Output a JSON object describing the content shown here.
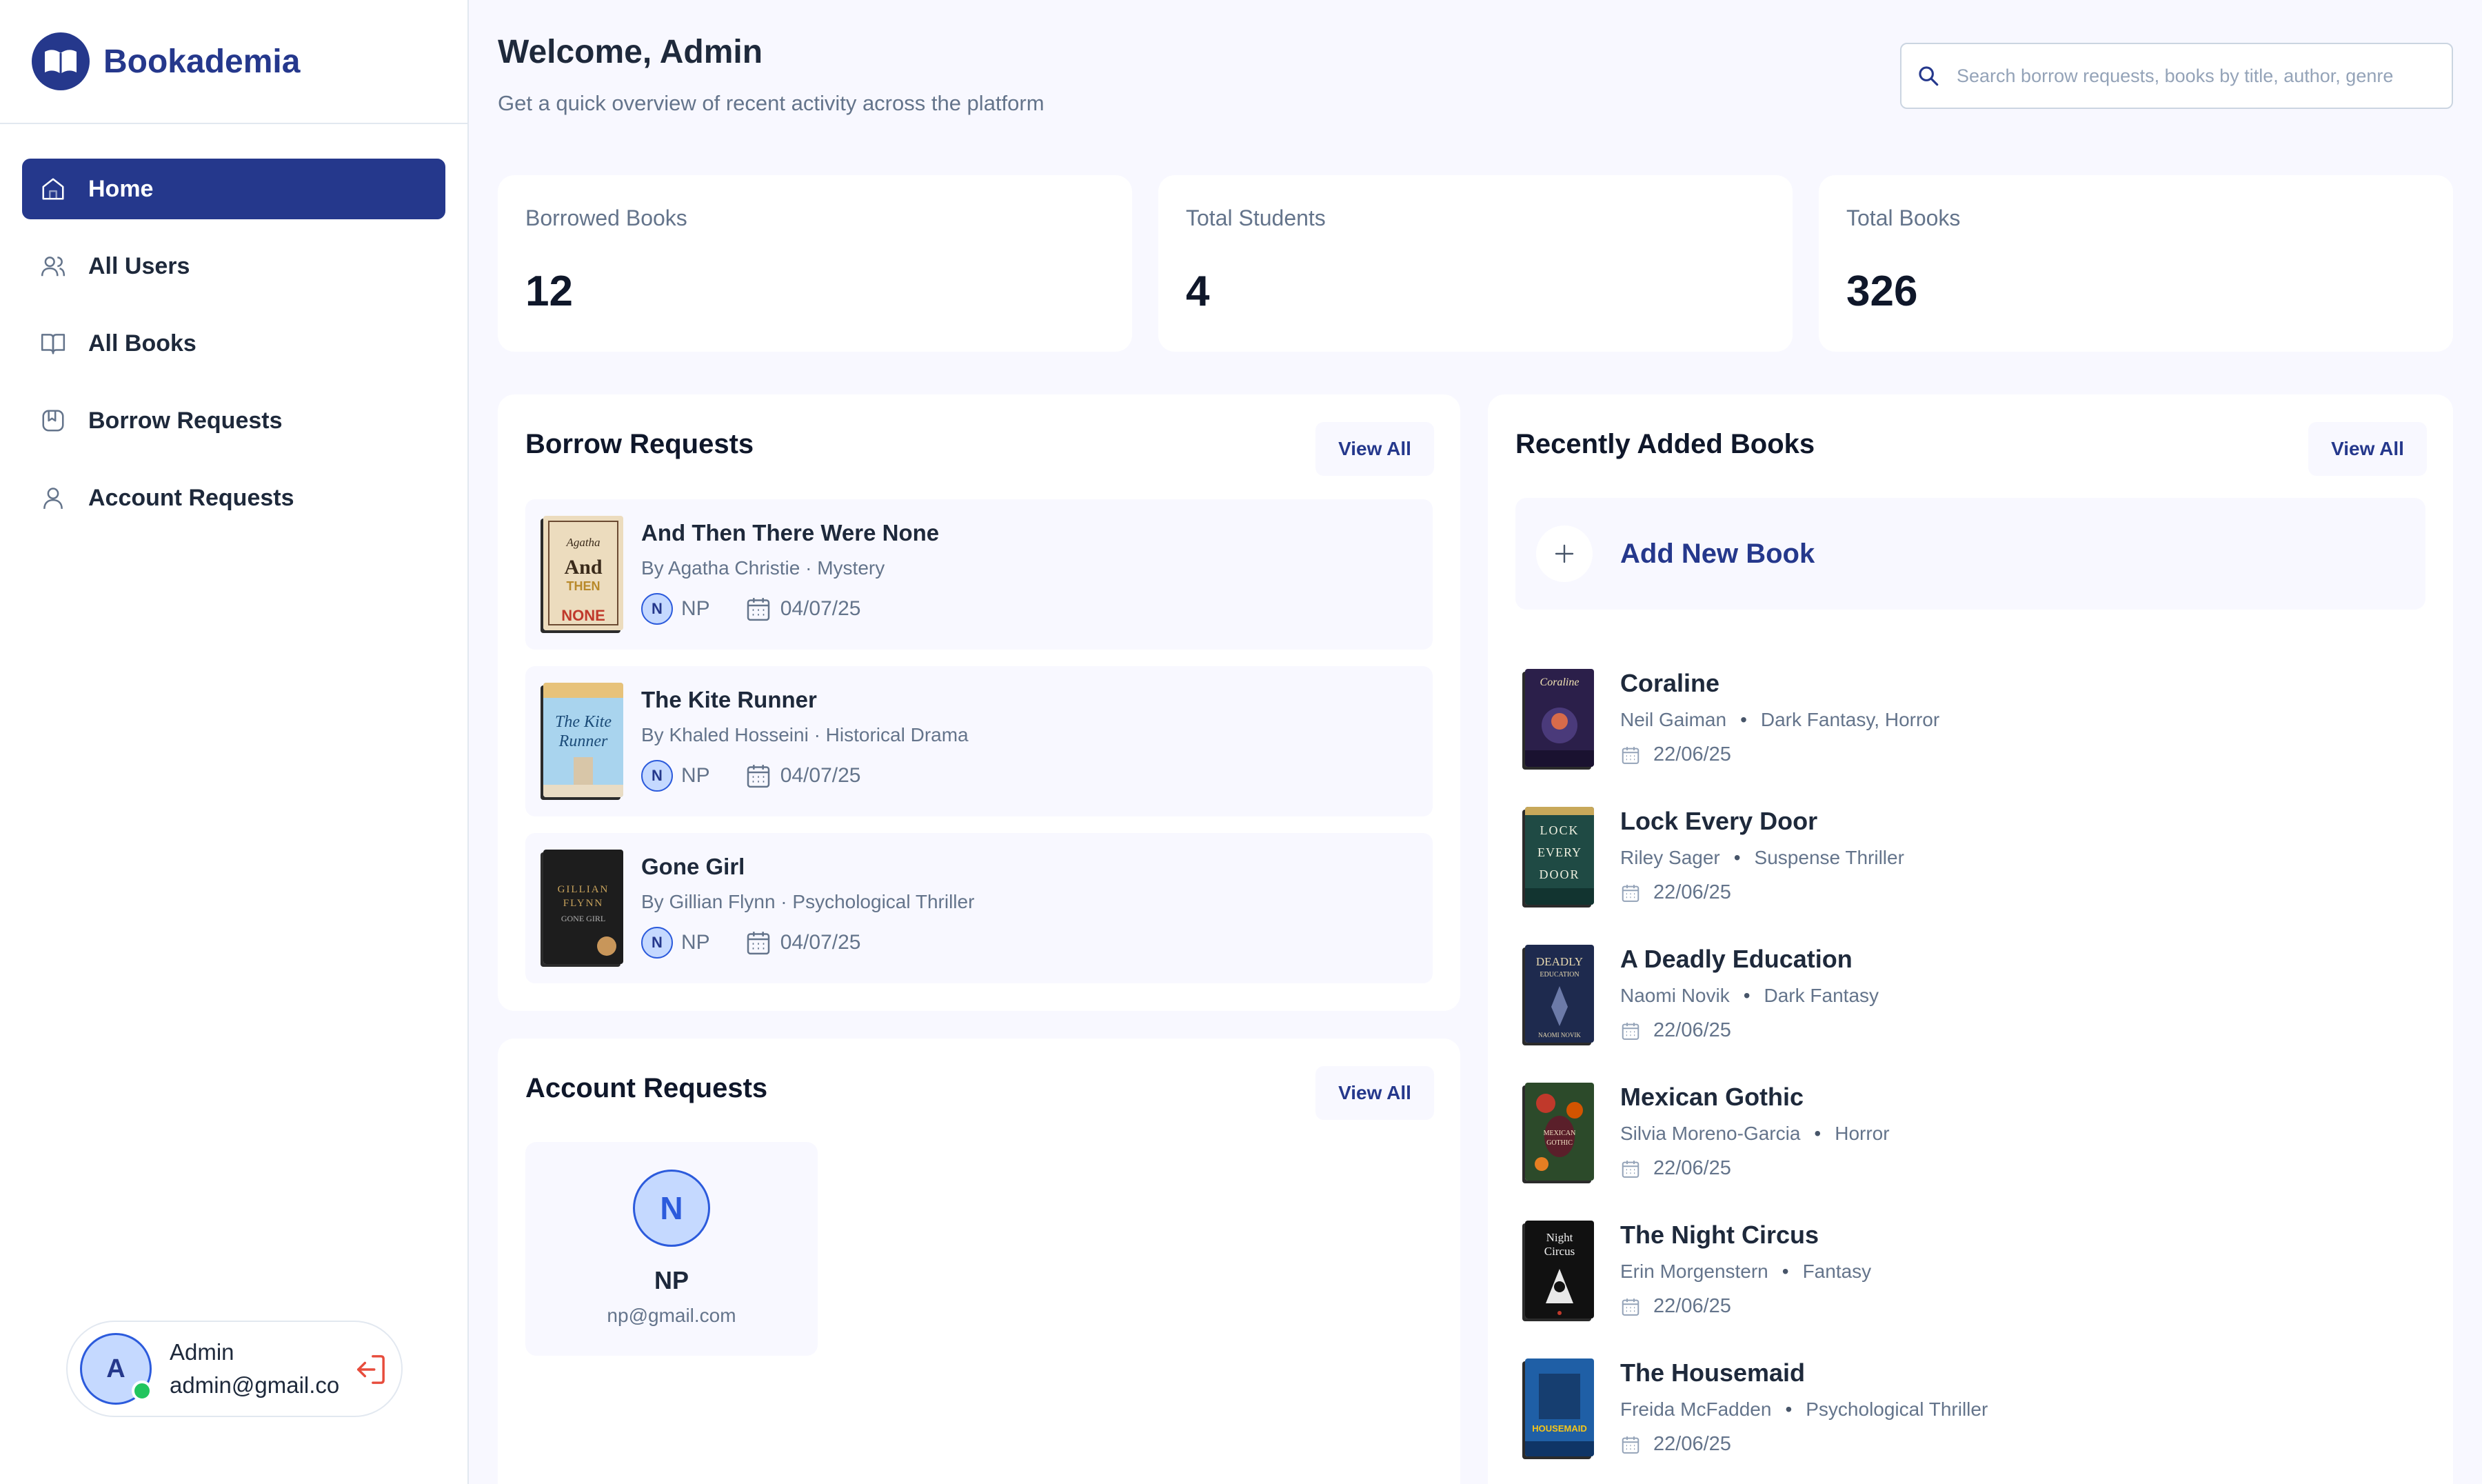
{
  "app": {
    "brand_name": "Bookademia"
  },
  "sidebar": {
    "items": [
      {
        "label": "Home",
        "icon": "home-icon",
        "active": true
      },
      {
        "label": "All Users",
        "icon": "users-icon"
      },
      {
        "label": "All Books",
        "icon": "book-open-icon"
      },
      {
        "label": "Borrow Requests",
        "icon": "bookmark-icon"
      },
      {
        "label": "Account Requests",
        "icon": "user-icon"
      }
    ],
    "profile": {
      "initial": "A",
      "name": "Admin",
      "email": "admin@gmail.co"
    }
  },
  "header": {
    "title": "Welcome, Admin",
    "subtitle": "Get a quick overview of recent activity across the platform",
    "search_placeholder": "Search borrow requests, books by title, author, genre"
  },
  "stats": [
    {
      "label": "Borrowed Books",
      "value": "12"
    },
    {
      "label": "Total Students",
      "value": "4"
    },
    {
      "label": "Total Books",
      "value": "326"
    }
  ],
  "borrow_requests": {
    "title": "Borrow Requests",
    "view_all": "View All",
    "items": [
      {
        "title": "And Then There Were None",
        "subtitle": "By Agatha Christie · Mystery",
        "user_initial": "N",
        "user": "NP",
        "date": "04/07/25"
      },
      {
        "title": "The Kite Runner",
        "subtitle": "By Khaled Hosseini · Historical Drama",
        "user_initial": "N",
        "user": "NP",
        "date": "04/07/25"
      },
      {
        "title": "Gone Girl",
        "subtitle": "By Gillian Flynn · Psychological Thriller",
        "user_initial": "N",
        "user": "NP",
        "date": "04/07/25"
      }
    ]
  },
  "account_requests": {
    "title": "Account Requests",
    "view_all": "View All",
    "items": [
      {
        "initial": "N",
        "name": "NP",
        "email": "np@gmail.com"
      }
    ]
  },
  "recent_books": {
    "title": "Recently Added Books",
    "view_all": "View All",
    "add_label": "Add New Book",
    "items": [
      {
        "title": "Coraline",
        "author": "Neil Gaiman",
        "genre": "Dark Fantasy, Horror",
        "date": "22/06/25"
      },
      {
        "title": "Lock Every Door",
        "author": "Riley Sager",
        "genre": "Suspense Thriller",
        "date": "22/06/25"
      },
      {
        "title": "A Deadly Education",
        "author": "Naomi Novik",
        "genre": "Dark Fantasy",
        "date": "22/06/25"
      },
      {
        "title": "Mexican Gothic",
        "author": "Silvia Moreno-Garcia",
        "genre": "Horror",
        "date": "22/06/25"
      },
      {
        "title": "The Night Circus",
        "author": "Erin Morgenstern",
        "genre": "Fantasy",
        "date": "22/06/25"
      },
      {
        "title": "The Housemaid",
        "author": "Freida McFadden",
        "genre": "Psychological Thriller",
        "date": "22/06/25"
      }
    ]
  },
  "covers": {
    "and_then": "AND THEN THERE WERE NONE",
    "kite": "The Kite Runner",
    "gone": "GILLIAN FLYNN GONE GIRL",
    "coraline": "Coraline",
    "lock": "LOCK EVERY DOOR",
    "deadly": "DEADLY EDUCATION",
    "mexican": "MEXICAN GOTHIC",
    "night": "Night Circus",
    "housemaid": "HOUSEMAID"
  },
  "colors": {
    "brand": "#25388c",
    "background": "#f8f8ff",
    "muted_text": "#64748b",
    "online": "#22c55e",
    "logout": "#e74c3c"
  }
}
